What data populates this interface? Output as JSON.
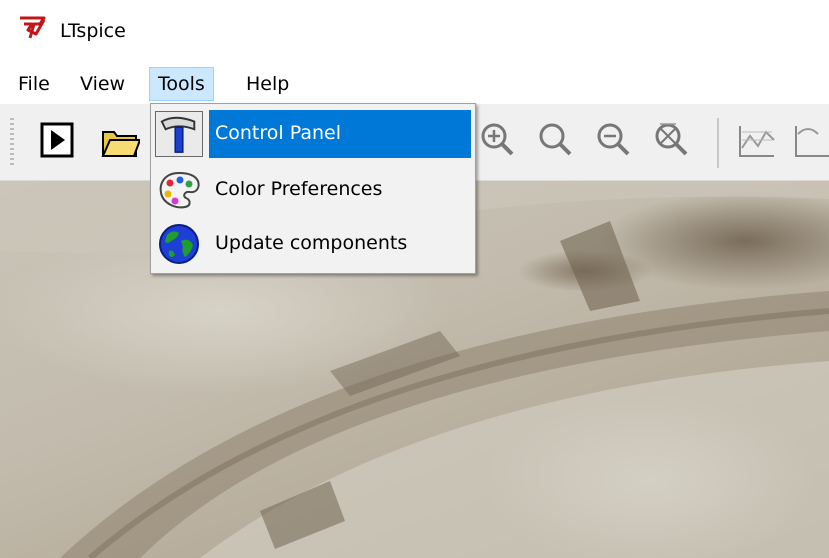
{
  "window": {
    "title": "LTspice",
    "logo": "ltspice-logo-icon"
  },
  "menubar": {
    "items": [
      "File",
      "View",
      "Tools",
      "Help"
    ],
    "open": "Tools"
  },
  "toolbar": {
    "icons": [
      "run-icon",
      "open-folder-icon",
      "zoom-in-icon",
      "zoom-full-icon",
      "zoom-out-icon",
      "zoom-cancel-icon",
      "waveform-icon"
    ]
  },
  "tools_menu": {
    "items": [
      {
        "label": "Control Panel",
        "icon": "hammer-icon",
        "highlighted": true
      },
      {
        "label": "Color Preferences",
        "icon": "palette-icon",
        "highlighted": false
      },
      {
        "label": "Update components",
        "icon": "globe-icon",
        "highlighted": false
      }
    ]
  },
  "colors": {
    "highlight": "#0078d7",
    "menu_open": "#cce8ff",
    "toolbar": "#f0f0f0",
    "logo_red": "#c0161b"
  }
}
